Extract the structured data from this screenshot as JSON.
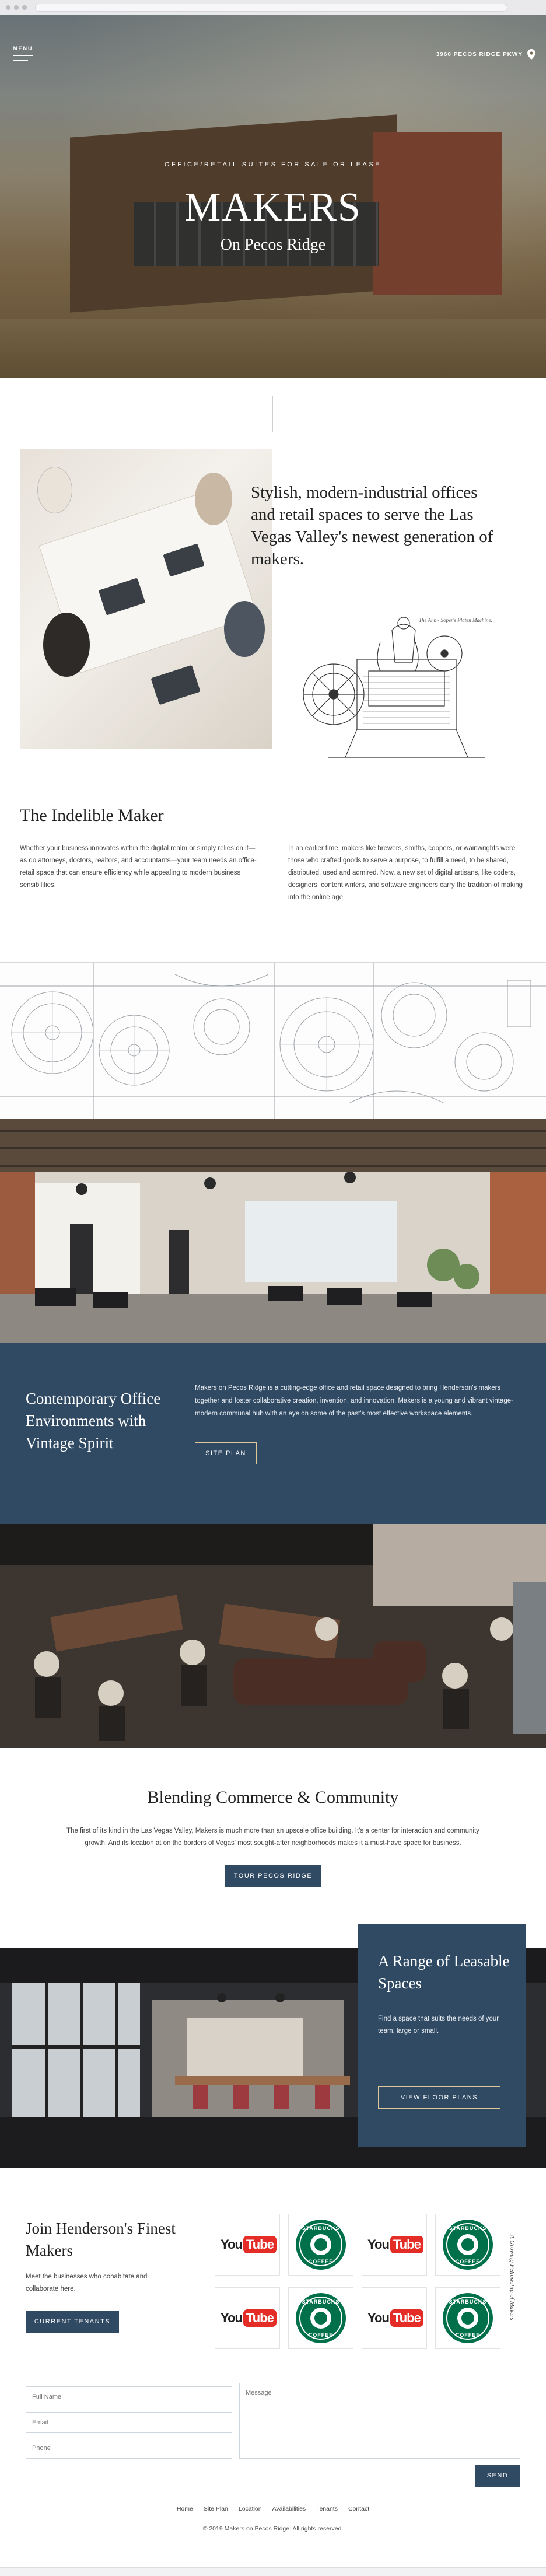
{
  "header": {
    "menu_label": "MENU",
    "address": "3960 PECOS RIDGE PKWY"
  },
  "hero": {
    "subtitle": "OFFICE/RETAIL SUITES FOR SALE OR LEASE",
    "title": "MAKERS",
    "tagline": "On Pecos Ridge"
  },
  "intro": {
    "heading": "Stylish, modern-industrial offices and retail spaces to serve the Las Vegas Valley's newest generation of makers.",
    "press_caption": "The Ann - Soper's Platen Machine."
  },
  "indelible": {
    "title": "The Indelible Maker",
    "left_text": "Whether your business innovates within the digital realm or simply relies on it—as do attorneys, doctors, realtors, and accountants—your team needs an office-retail space that can ensure efficiency while appealing to modern business sensibilities.",
    "right_text": "In an earlier time, makers like brewers, smiths, coopers, or wainwrights were those who crafted goods to serve a purpose, to fulfill a need, to be shared, distributed, used and admired. Now, a new set of digital artisans, like coders, designers, content writers, and software engineers carry the tradition of making into the online age."
  },
  "contemporary": {
    "title": "Contemporary Office Environments with Vintage Spirit",
    "text": "Makers on Pecos Ridge is a cutting-edge office and retail space designed to bring Henderson's makers together and foster collaborative creation, invention, and innovation. Makers is a young and vibrant vintage-modern communal hub with an eye on some of the past's most effective workspace elements.",
    "button": "SITE PLAN"
  },
  "blending": {
    "title": "Blending Commerce & Community",
    "text": "The first of its kind in the Las Vegas Valley, Makers is much more than an upscale office building. It's a center for interaction and community growth. And its location at on the borders of Vegas' most sought-after neighborhoods makes it a must-have space for business.",
    "button": "TOUR PECOS RIDGE"
  },
  "range": {
    "title": "A Range of Leasable Spaces",
    "text": "Find a space that suits the needs of your team, large or small.",
    "button": "VIEW FLOOR PLANS"
  },
  "tenants": {
    "title": "Join Henderson's Finest Makers",
    "text": "Meet the businesses who cohabitate and collaborate here.",
    "button": "CURRENT TENANTS",
    "vertical_caption": "A Growing Fellowship of Makers",
    "logos": [
      {
        "type": "youtube",
        "you": "You",
        "tube": "Tube"
      },
      {
        "type": "starbucks",
        "top": "STARBUCKS",
        "bottom": "COFFEE"
      },
      {
        "type": "youtube",
        "you": "You",
        "tube": "Tube"
      },
      {
        "type": "starbucks",
        "top": "STARBUCKS",
        "bottom": "COFFEE"
      },
      {
        "type": "youtube",
        "you": "You",
        "tube": "Tube"
      },
      {
        "type": "starbucks",
        "top": "STARBUCKS",
        "bottom": "COFFEE"
      },
      {
        "type": "youtube",
        "you": "You",
        "tube": "Tube"
      },
      {
        "type": "starbucks",
        "top": "STARBUCKS",
        "bottom": "COFFEE"
      }
    ]
  },
  "contact": {
    "name_placeholder": "Full Name",
    "email_placeholder": "Email",
    "phone_placeholder": "Phone",
    "message_placeholder": "Message",
    "send_label": "SEND"
  },
  "footer": {
    "nav": [
      "Home",
      "Site Plan",
      "Location",
      "Availabilities",
      "Tenants",
      "Contact"
    ],
    "copyright": "© 2019 Makers on Pecos Ridge. All rights reserved."
  },
  "colors": {
    "navy": "#304a64",
    "gold_outline": "#e0c79a",
    "youtube_red": "#e52d27",
    "starbucks_green": "#00704a"
  }
}
